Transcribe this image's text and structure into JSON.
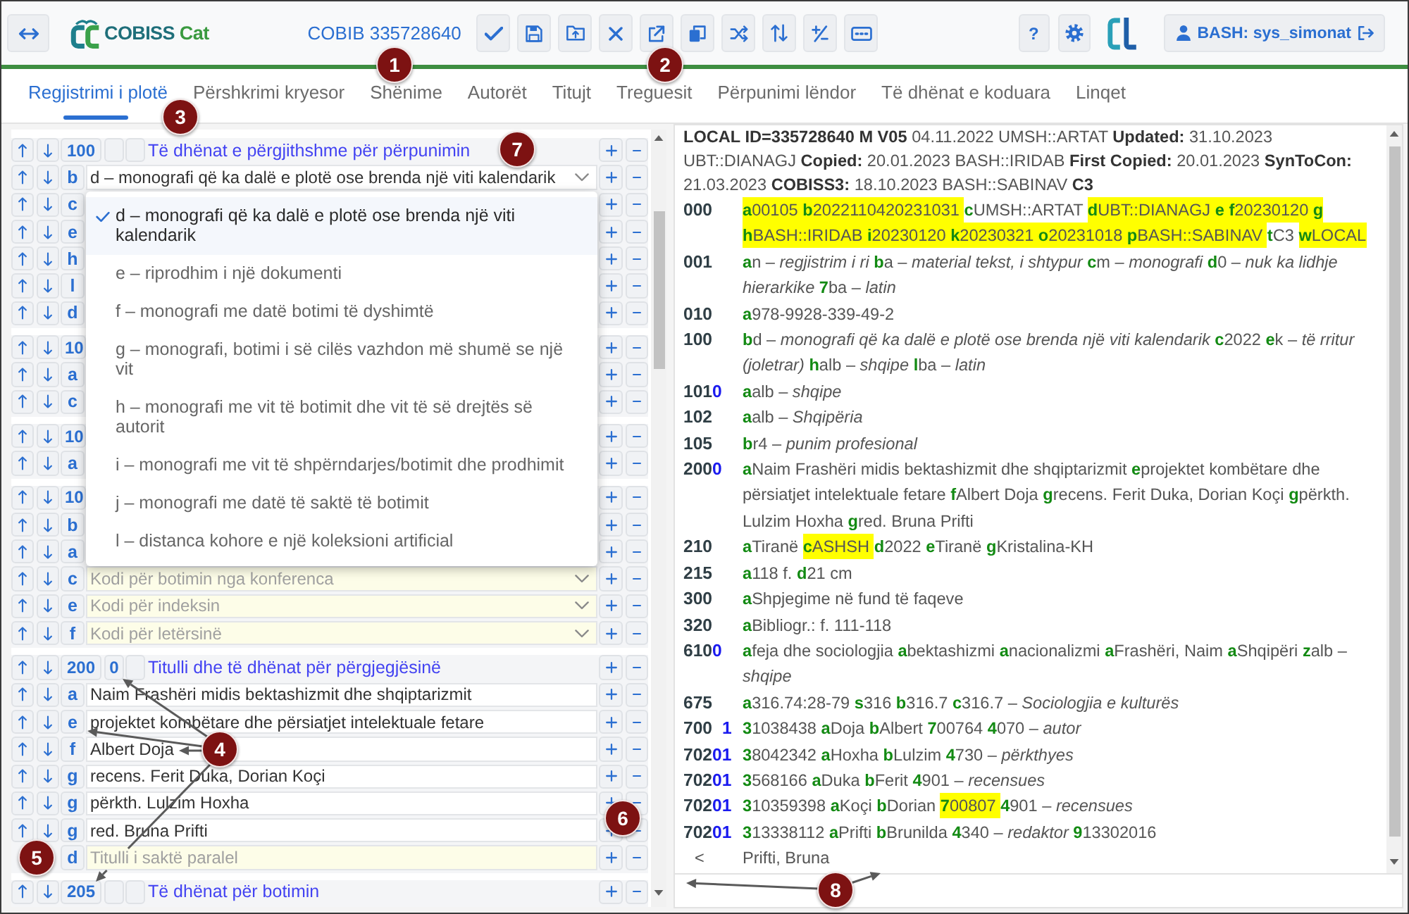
{
  "topbar": {
    "logo": {
      "name": "COBISS",
      "product": "Cat"
    },
    "record_id": "COBIB 335728640",
    "tools": [
      {
        "kind": "check"
      },
      {
        "kind": "save"
      },
      {
        "kind": "folder"
      },
      {
        "kind": "close"
      },
      {
        "kind": "external"
      },
      {
        "kind": "copy"
      },
      {
        "kind": "shuffle"
      },
      {
        "kind": "sort"
      },
      {
        "kind": "plusminus"
      },
      {
        "kind": "keyboard"
      }
    ],
    "help": "?",
    "user": "BASH: sys_simonat"
  },
  "tabs": [
    {
      "label": "Regjistrimi i plotë",
      "selected": true
    },
    {
      "label": "Përshkrimi kryesor",
      "selected": false
    },
    {
      "label": "Shënime",
      "selected": false
    },
    {
      "label": "Autorët",
      "selected": false
    },
    {
      "label": "Titujt",
      "selected": false
    },
    {
      "label": "Treguesit",
      "selected": false
    },
    {
      "label": "Përpunimi lëndor",
      "selected": false
    },
    {
      "label": "Të dhënat e koduara",
      "selected": false
    },
    {
      "label": "Linqet",
      "selected": false
    }
  ],
  "editor": {
    "fields": [
      {
        "rows": [
          {
            "kind": "header",
            "tag": "100",
            "title": "Të dhënat e përgjithshme për përpunimin"
          },
          {
            "kind": "select",
            "code": "b",
            "value": "d – monografi që ka dalë e plotë ose brenda një viti kalendarik",
            "open": true,
            "options": [
              {
                "label": "d – monografi që ka dalë e plotë ose brenda një viti kalendarik",
                "selected": true
              },
              {
                "label": "e – riprodhim i një dokumenti",
                "selected": false
              },
              {
                "label": "f – monografi me datë botimi të dyshimtë",
                "selected": false
              },
              {
                "label": "g – monografi, botimi i së cilës vazhdon më shumë se një vit",
                "selected": false
              },
              {
                "label": "h – monografi me vit të botimit dhe vit të së drejtës së autorit",
                "selected": false
              },
              {
                "label": "i – monografi me vit të shpërndarjes/botimit dhe prodhimit",
                "selected": false
              },
              {
                "label": "j – monografi me datë të saktë të botimit",
                "selected": false
              },
              {
                "label": "l – distanca kohore e një koleksioni artificial",
                "selected": false
              }
            ]
          },
          {
            "kind": "covered",
            "code": "c"
          },
          {
            "kind": "covered",
            "code": "e"
          },
          {
            "kind": "covered",
            "code": "h"
          },
          {
            "kind": "covered",
            "code": "l"
          },
          {
            "kind": "covered",
            "code": "d"
          }
        ]
      },
      {
        "rows": [
          {
            "kind": "covered",
            "tag": "10"
          },
          {
            "kind": "covered",
            "code": "a"
          },
          {
            "kind": "covered",
            "code": "c"
          }
        ]
      },
      {
        "rows": [
          {
            "kind": "covered",
            "tag": "10"
          },
          {
            "kind": "covered",
            "code": "a"
          }
        ]
      },
      {
        "rows": [
          {
            "kind": "covered",
            "tag": "10"
          },
          {
            "kind": "covered",
            "code": "b"
          },
          {
            "kind": "covered",
            "code": "a"
          },
          {
            "kind": "select",
            "code": "c",
            "placeholder": "Kodi për botimin nga konferenca"
          },
          {
            "kind": "select",
            "code": "e",
            "placeholder": "Kodi për indeksin"
          },
          {
            "kind": "select",
            "code": "f",
            "placeholder": "Kodi për letërsinë"
          }
        ]
      },
      {
        "rows": [
          {
            "kind": "header",
            "tag": "200",
            "ind1": "0",
            "title": "Titulli dhe të dhënat për përgjegjësinë"
          },
          {
            "kind": "text",
            "code": "a",
            "value": "Naim Frashëri midis bektashizmit dhe shqiptarizmit"
          },
          {
            "kind": "text",
            "code": "e",
            "value": "projektet kombëtare dhe përsiatjet intelektuale fetare"
          },
          {
            "kind": "text",
            "code": "f",
            "value": "Albert Doja"
          },
          {
            "kind": "text",
            "code": "g",
            "value": "recens. Ferit Duka, Dorian Koçi"
          },
          {
            "kind": "text",
            "code": "g",
            "value": "përkth. Lulzim Hoxha"
          },
          {
            "kind": "text",
            "code": "g",
            "value": "red. Bruna Prifti"
          },
          {
            "kind": "text",
            "code": "d",
            "placeholder": "Titulli i saktë paralel"
          }
        ]
      },
      {
        "rows": [
          {
            "kind": "header",
            "tag": "205",
            "title": "Të dhënat për botimin"
          }
        ]
      }
    ]
  },
  "record": {
    "header": "**LOCAL ID=335728640 M V05** 04.11.2022 UMSH::ARTAT **Updated:** 31.10.2023 UBT::DIANAGJ **Copied:** 20.01.2023 BASH::IRIDAB **First Copied:** 20.01.2023 **SynToCon:** 21.03.2023 **COBISS3:** 18.10.2023 BASH::SABINAV **C3**",
    "fields": [
      {
        "kind": "field",
        "tag": "000",
        "subfields": [
          {
            "code": "a",
            "value": "00105",
            "highlight": true
          },
          {
            "code": "b",
            "value": "2022110420231031",
            "highlight": true
          },
          {
            "code": "c",
            "value": "UMSH::ARTAT",
            "highlight": false
          },
          {
            "code": "d",
            "value": "UBT::DIANAGJ",
            "highlight": true
          },
          {
            "code": "e",
            "highlight": true
          },
          {
            "code": "f",
            "value": "20230120",
            "highlight": true
          },
          {
            "code": "g",
            "highlight": true
          },
          {
            "code": "h",
            "value": "BASH::IRIDAB",
            "highlight": true
          },
          {
            "code": "i",
            "value": "20230120",
            "highlight": true
          },
          {
            "code": "k",
            "value": "20230321",
            "highlight": true
          },
          {
            "code": "o",
            "value": "20231018",
            "highlight": true
          },
          {
            "code": "p",
            "value": "BASH::SABINAV",
            "highlight": true
          },
          {
            "code": "t",
            "value": "C3",
            "highlight": false
          },
          {
            "code": "w",
            "value": "LOCAL",
            "highlight": true
          }
        ]
      },
      {
        "kind": "field",
        "tag": "001",
        "subfields": [
          {
            "code": "a",
            "value": "n – *regjistrim i ri*",
            "highlight": false
          },
          {
            "code": "b",
            "value": "a – *material tekst, i shtypur*",
            "highlight": false
          },
          {
            "code": "c",
            "value": "m – *monografi*",
            "highlight": false
          },
          {
            "code": "d",
            "value": "0 – *nuk ka lidhje hierarkike*",
            "highlight": false
          },
          {
            "code": "7",
            "value": "ba – *latin*",
            "highlight": false
          }
        ]
      },
      {
        "kind": "field",
        "tag": "010",
        "subfields": [
          {
            "code": "a",
            "value": "978-9928-339-49-2",
            "highlight": false
          }
        ]
      },
      {
        "kind": "field",
        "tag": "100",
        "subfields": [
          {
            "code": "b",
            "value": "d – *monografi që ka dalë e plotë ose brenda një viti kalendarik*",
            "highlight": false
          },
          {
            "code": "c",
            "value": "2022",
            "highlight": false
          },
          {
            "code": "e",
            "value": "k – *të rritur (joletrar)*",
            "highlight": false
          },
          {
            "code": "h",
            "value": "alb – *shqipe*",
            "highlight": false
          },
          {
            "code": "l",
            "value": "ba – *latin*",
            "highlight": false
          }
        ]
      },
      {
        "kind": "field",
        "tag": "101",
        "ind1": "0",
        "subfields": [
          {
            "code": "a",
            "value": "alb – *shqipe*",
            "highlight": false
          }
        ]
      },
      {
        "kind": "field",
        "tag": "102",
        "subfields": [
          {
            "code": "a",
            "value": "alb – *Shqipëria*",
            "highlight": false
          }
        ]
      },
      {
        "kind": "field",
        "tag": "105",
        "subfields": [
          {
            "code": "b",
            "value": "r4 – *punim profesional*",
            "highlight": false
          }
        ]
      },
      {
        "kind": "field",
        "tag": "200",
        "ind1": "0",
        "subfields": [
          {
            "code": "a",
            "value": "Naim Frashëri midis bektashizmit dhe shqiptarizmit",
            "highlight": false
          },
          {
            "code": "e",
            "value": "projektet kombëtare dhe përsiatjet intelektuale fetare",
            "highlight": false
          },
          {
            "code": "f",
            "value": "Albert Doja",
            "highlight": false
          },
          {
            "code": "g",
            "value": "recens. Ferit Duka, Dorian Koçi",
            "highlight": false
          },
          {
            "code": "g",
            "value": "përkth. Lulzim Hoxha",
            "highlight": false
          },
          {
            "code": "g",
            "value": "red. Bruna Prifti",
            "highlight": false
          }
        ]
      },
      {
        "kind": "field",
        "tag": "210",
        "subfields": [
          {
            "code": "a",
            "value": "Tiranë",
            "highlight": false
          },
          {
            "code": "c",
            "value": "ASHSH",
            "highlight": true
          },
          {
            "code": "d",
            "value": "2022",
            "highlight": false
          },
          {
            "code": "e",
            "value": "Tiranë",
            "highlight": false
          },
          {
            "code": "g",
            "value": "Kristalina-KH",
            "highlight": false
          }
        ]
      },
      {
        "kind": "field",
        "tag": "215",
        "subfields": [
          {
            "code": "a",
            "value": "118 f.",
            "highlight": false
          },
          {
            "code": "d",
            "value": "21 cm",
            "highlight": false
          }
        ]
      },
      {
        "kind": "field",
        "tag": "300",
        "subfields": [
          {
            "code": "a",
            "value": "Shpjegime në fund të faqeve",
            "highlight": false
          }
        ]
      },
      {
        "kind": "field",
        "tag": "320",
        "subfields": [
          {
            "code": "a",
            "value": "Bibliogr.: f. 111-118",
            "highlight": false
          }
        ]
      },
      {
        "kind": "field",
        "tag": "610",
        "ind1": "0",
        "subfields": [
          {
            "code": "a",
            "value": "feja dhe sociologjia",
            "highlight": false
          },
          {
            "code": "a",
            "value": "bektashizmi",
            "highlight": false
          },
          {
            "code": "a",
            "value": "nacionalizmi",
            "highlight": false
          },
          {
            "code": "a",
            "value": "Frashëri, Naim",
            "highlight": false
          },
          {
            "code": "a",
            "value": "Shqipëri",
            "highlight": false
          },
          {
            "code": "z",
            "value": "alb – *shqipe*",
            "highlight": false
          }
        ]
      },
      {
        "kind": "field",
        "tag": "675",
        "subfields": [
          {
            "code": "a",
            "value": "316.74:28-79",
            "highlight": false
          },
          {
            "code": "s",
            "value": "316",
            "highlight": false
          },
          {
            "code": "b",
            "value": "316.7",
            "highlight": false
          },
          {
            "code": "c",
            "value": "316.7 – *Sociologjia e kulturës*",
            "highlight": false
          }
        ]
      },
      {
        "kind": "field",
        "tag": "700",
        "ind2": "1",
        "subfields": [
          {
            "code": "3",
            "value": "1038438",
            "highlight": false
          },
          {
            "code": "a",
            "value": "Doja",
            "highlight": false
          },
          {
            "code": "b",
            "value": "Albert",
            "highlight": false
          },
          {
            "code": "7",
            "value": "00764",
            "highlight": false
          },
          {
            "code": "4",
            "value": "070 – *autor*",
            "highlight": false
          }
        ]
      },
      {
        "kind": "field",
        "tag": "702",
        "ind1": "0",
        "ind2": "1",
        "subfields": [
          {
            "code": "3",
            "value": "8042342",
            "highlight": false
          },
          {
            "code": "a",
            "value": "Hoxha",
            "highlight": false
          },
          {
            "code": "b",
            "value": "Lulzim",
            "highlight": false
          },
          {
            "code": "4",
            "value": "730 – *përkthyes*",
            "highlight": false
          }
        ]
      },
      {
        "kind": "field",
        "tag": "702",
        "ind1": "0",
        "ind2": "1",
        "subfields": [
          {
            "code": "3",
            "value": "568166",
            "highlight": false
          },
          {
            "code": "a",
            "value": "Duka",
            "highlight": false
          },
          {
            "code": "b",
            "value": "Ferit",
            "highlight": false
          },
          {
            "code": "4",
            "value": "901 – *recensues*",
            "highlight": false
          }
        ]
      },
      {
        "kind": "field",
        "tag": "702",
        "ind1": "0",
        "ind2": "1",
        "subfields": [
          {
            "code": "3",
            "value": "10359398",
            "highlight": false
          },
          {
            "code": "a",
            "value": "Koçi",
            "highlight": false
          },
          {
            "code": "b",
            "value": "Dorian",
            "highlight": false
          },
          {
            "code": "7",
            "value": "00807",
            "highlight": true
          },
          {
            "code": "4",
            "value": "901 – *recensues*",
            "highlight": false
          }
        ]
      },
      {
        "kind": "field",
        "tag": "702",
        "ind1": "0",
        "ind2": "1",
        "subfields": [
          {
            "code": "3",
            "value": "13338112",
            "highlight": false
          },
          {
            "code": "a",
            "value": "Prifti",
            "highlight": false
          },
          {
            "code": "b",
            "value": "Brunilda",
            "highlight": false
          },
          {
            "code": "4",
            "value": "340 – *redaktor*",
            "highlight": false
          },
          {
            "code": "9",
            "value": "13302016",
            "highlight": false
          }
        ]
      },
      {
        "kind": "note",
        "tag": "<",
        "text": "Prifti, Bruna"
      }
    ]
  },
  "callouts": [
    {
      "number": "1"
    },
    {
      "number": "2"
    },
    {
      "number": "3"
    },
    {
      "number": "4"
    },
    {
      "number": "5"
    },
    {
      "number": "6"
    },
    {
      "number": "7"
    },
    {
      "number": "8"
    }
  ]
}
